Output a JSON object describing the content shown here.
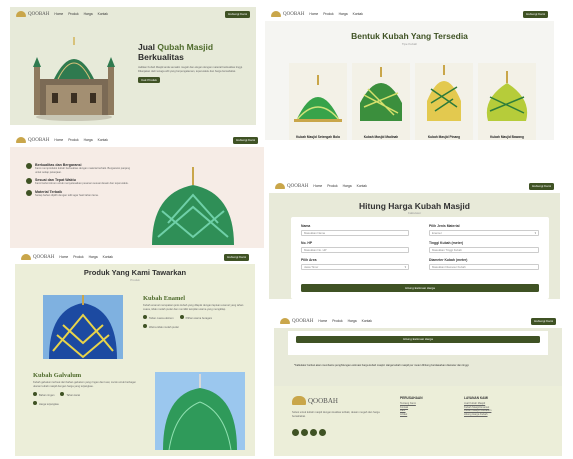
{
  "brand": "QOOBAH",
  "nav": {
    "links": [
      "Home",
      "Produk",
      "Harga",
      "Kontak"
    ],
    "cta": "Hubungi Kami"
  },
  "hero": {
    "title_1": "Jual ",
    "title_2": "Qubah Masjid",
    "title_3": "Berkualitas",
    "body": "Jadikan Kubah Masjid anda semakin megah dan elegan dengan material berkualitas tinggi. Dikerjakan oleh tenaga ahli yang berpengalaman, tepat waktu dan harga bersahabat.",
    "button": "Cek Produk"
  },
  "shapes": {
    "title": "Bentuk Kubah Yang Tersedia",
    "subtitle": "Tipe Kubah",
    "items": [
      "Kubah Masjid Setengah Bola",
      "Kubah Masjid Madinah",
      "Kubah Masjid Pinang",
      "Kubah Masjid Bawang"
    ]
  },
  "features": [
    {
      "title": "Berkualitas dan Bergaransi",
      "desc": "Kami memproduksi kubah berkualitas dengan material terbaik. Bergaransi panjang untuk setiap pekerjaan."
    },
    {
      "title": "Sesuai dan Tepat Waktu",
      "desc": "Kami berkomitmen untuk menyelesaikan pesanan sesuai desain dan tepat waktu."
    },
    {
      "title": "Material Terbaik",
      "desc": "Setiap bahan dipilih dengan teliti agar hasil tahan lama."
    }
  ],
  "calc": {
    "title": "Hitung Harga Kubah Masjid",
    "subtitle": "Kalkulator",
    "fields": {
      "name_label": "Nama",
      "name_ph": "Masukkan Nama",
      "phone_label": "No. HP",
      "phone_ph": "Masukkan No. HP",
      "area_label": "Pilih Area",
      "area_val": "Jawa Timur",
      "material_label": "Pilih Jenis Material",
      "material_val": "Enamel",
      "height_label": "Tinggi Kubah (meter)",
      "height_ph": "Masukkan Tinggi Kubah",
      "diameter_label": "Diameter Kubah (meter)",
      "diameter_ph": "Masukkan Diameter Kubah"
    },
    "button": "Hitung Estimasi Harga"
  },
  "products": {
    "title": "Produk Yang Kami Tawarkan",
    "subtitle": "Produk",
    "enamel": {
      "name": "Kubah Enamel",
      "desc": "Kubah enamel merupakan jenis kubah yang dilapisi dengan lapisan enamel yang tahan cuaca, tidak mudah pudar dan memiliki tampilan warna yang mengkilap.",
      "tags": [
        "Tahan cuaca ekstrem",
        "Pilihan warna beragam",
        "Warna tidak mudah pudar"
      ]
    },
    "galvalum": {
      "name": "Kubah Galvalum",
      "desc": "Kubah galvalum terbuat dari bahan galvalum yang ringan dan kuat, cocok untuk berbagai ukuran kubah masjid dengan harga yang terjangkau.",
      "tags": [
        "Bahan ringan",
        "Tahan karat",
        "Harga terjangkau"
      ]
    }
  },
  "footer": {
    "calc_button": "Hitung Estimasi Harga",
    "note": "*Kalkulator berikut akan membantu penghitungan estimasi harga kubah masjid. Harga kubah masjid per meter dihitung berdasarkan diameter dan tinggi.",
    "about": "Solusi untuk kubah masjid dengan kualitas terbaik, desain megah dan harga bersahabat.",
    "col1_title": "PERUSAHAAN",
    "col1": [
      "Tentang Kami",
      "Kontak",
      "Karir",
      "Artikel"
    ],
    "col2_title": "LAYANAN KAMI",
    "col2": [
      "Jual Kubah Masjid",
      "Kubah Masjid Enamel",
      "Kubah Masjid Galvalum",
      "Hitung Harga Kubah"
    ]
  }
}
